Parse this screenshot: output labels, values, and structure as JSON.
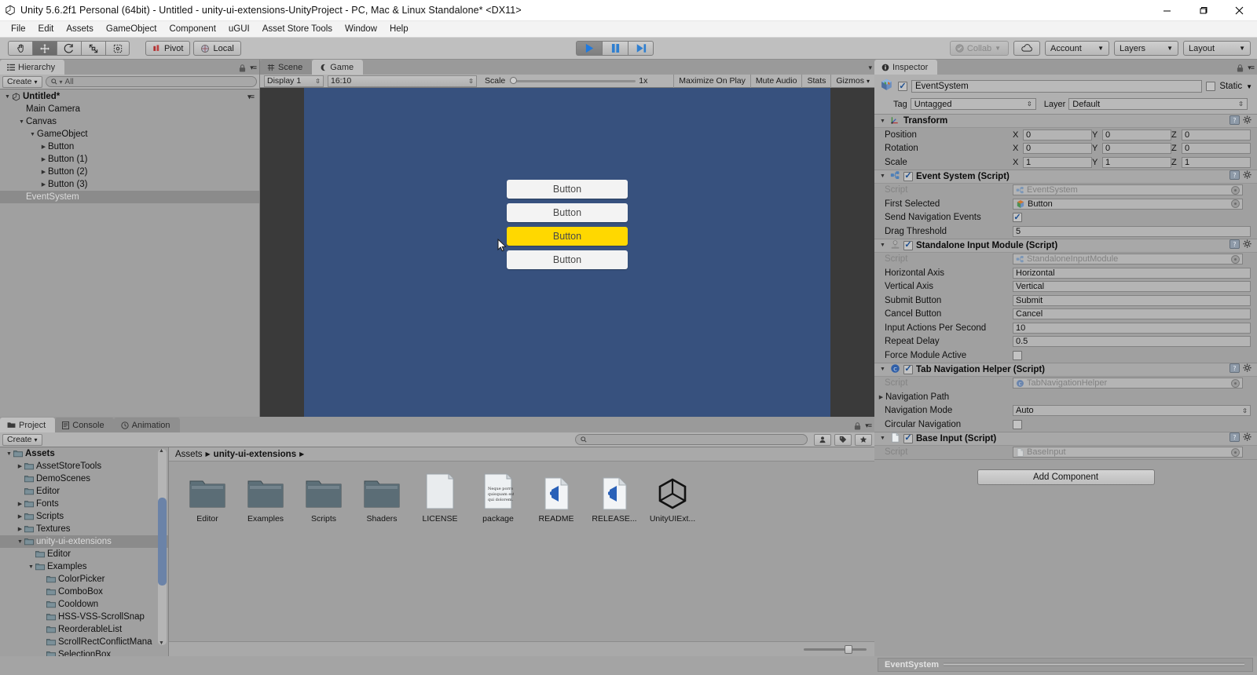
{
  "window": {
    "title": "Unity 5.6.2f1 Personal (64bit) - Untitled - unity-ui-extensions-UnityProject - PC, Mac & Linux Standalone* <DX11>",
    "minimize": "—",
    "maximize": "❐",
    "close": "✕"
  },
  "menubar": {
    "items": [
      "File",
      "Edit",
      "Assets",
      "GameObject",
      "Component",
      "uGUI",
      "Asset Store Tools",
      "Window",
      "Help"
    ]
  },
  "toolbar": {
    "tools": [
      "hand-tool",
      "move-tool",
      "rotate-tool",
      "scale-tool",
      "rect-tool"
    ],
    "active_tool_index": 1,
    "pivot_label": "Pivot",
    "local_label": "Local",
    "play_label": "play-button",
    "pause_label": "pause-button",
    "step_label": "step-button",
    "playing": true,
    "collab_label": "Collab",
    "cloud_label": "cloud-button",
    "account_label": "Account",
    "layers_label": "Layers",
    "layout_label": "Layout"
  },
  "hierarchy": {
    "tab_label": "Hierarchy",
    "create_label": "Create",
    "search_placeholder": "All",
    "scene_name": "Untitled*",
    "items": [
      {
        "label": "Main Camera",
        "depth": 1,
        "arrow": "none",
        "selected": false
      },
      {
        "label": "Canvas",
        "depth": 1,
        "arrow": "open",
        "selected": false
      },
      {
        "label": "GameObject",
        "depth": 2,
        "arrow": "open",
        "selected": false
      },
      {
        "label": "Button",
        "depth": 3,
        "arrow": "closed",
        "selected": false
      },
      {
        "label": "Button (1)",
        "depth": 3,
        "arrow": "closed",
        "selected": false
      },
      {
        "label": "Button (2)",
        "depth": 3,
        "arrow": "closed",
        "selected": false
      },
      {
        "label": "Button (3)",
        "depth": 3,
        "arrow": "closed",
        "selected": false
      },
      {
        "label": "EventSystem",
        "depth": 1,
        "arrow": "none",
        "selected": true
      }
    ]
  },
  "gameview": {
    "tabs": [
      {
        "label": "Scene",
        "active": false,
        "icon": "scene-icon"
      },
      {
        "label": "Game",
        "active": true,
        "icon": "game-icon"
      }
    ],
    "display": "Display 1",
    "aspect": "16:10",
    "scale_label": "Scale",
    "scale_value": "1x",
    "maximize_on_play": "Maximize On Play",
    "mute_audio": "Mute Audio",
    "stats": "Stats",
    "gizmos": "Gizmos",
    "background_color": "#37517e",
    "buttons": [
      {
        "label": "Button",
        "highlighted": false
      },
      {
        "label": "Button",
        "highlighted": false
      },
      {
        "label": "Button",
        "highlighted": true
      },
      {
        "label": "Button",
        "highlighted": false
      }
    ],
    "highlight_color": "#ffd800",
    "button_color": "#f3f3f3"
  },
  "inspector": {
    "tab_label": "Inspector",
    "object_name": "EventSystem",
    "enabled": true,
    "static_label": "Static",
    "tag_label": "Tag",
    "tag_value": "Untagged",
    "layer_label": "Layer",
    "layer_value": "Default",
    "components": [
      {
        "title": "Transform",
        "icon": "transform-icon",
        "has_checkbox": false,
        "rows": [
          {
            "type": "vector3",
            "label": "Position",
            "x": "0",
            "y": "0",
            "z": "0"
          },
          {
            "type": "vector3",
            "label": "Rotation",
            "x": "0",
            "y": "0",
            "z": "0"
          },
          {
            "type": "vector3",
            "label": "Scale",
            "x": "1",
            "y": "1",
            "z": "1"
          }
        ]
      },
      {
        "title": "Event System (Script)",
        "icon": "script-icon",
        "has_checkbox": true,
        "checked": true,
        "rows": [
          {
            "type": "objref",
            "label": "Script",
            "value": "EventSystem",
            "dim": true,
            "icon": "script-icon"
          },
          {
            "type": "objref",
            "label": "First Selected",
            "value": "Button",
            "dim": false,
            "icon": "gameobject-icon"
          },
          {
            "type": "checkbox",
            "label": "Send Navigation Events",
            "checked": true
          },
          {
            "type": "text",
            "label": "Drag Threshold",
            "value": "5"
          }
        ]
      },
      {
        "title": "Standalone Input Module (Script)",
        "icon": "module-icon",
        "has_checkbox": true,
        "checked": true,
        "rows": [
          {
            "type": "objref",
            "label": "Script",
            "value": "StandaloneInputModule",
            "dim": true,
            "icon": "script-icon"
          },
          {
            "type": "text",
            "label": "Horizontal Axis",
            "value": "Horizontal"
          },
          {
            "type": "text",
            "label": "Vertical Axis",
            "value": "Vertical"
          },
          {
            "type": "text",
            "label": "Submit Button",
            "value": "Submit"
          },
          {
            "type": "text",
            "label": "Cancel Button",
            "value": "Cancel"
          },
          {
            "type": "text",
            "label": "Input Actions Per Second",
            "value": "10"
          },
          {
            "type": "text",
            "label": "Repeat Delay",
            "value": "0.5"
          },
          {
            "type": "checkbox",
            "label": "Force Module Active",
            "checked": false
          }
        ]
      },
      {
        "title": "Tab Navigation Helper (Script)",
        "icon": "csharp-icon",
        "has_checkbox": true,
        "checked": true,
        "rows": [
          {
            "type": "objref",
            "label": "Script",
            "value": "TabNavigationHelper",
            "dim": true,
            "icon": "csharp-icon"
          },
          {
            "type": "foldout",
            "label": "Navigation Path"
          },
          {
            "type": "dropdown",
            "label": "Navigation Mode",
            "value": "Auto"
          },
          {
            "type": "checkbox",
            "label": "Circular Navigation",
            "checked": false
          }
        ]
      },
      {
        "title": "Base Input (Script)",
        "icon": "file-icon",
        "has_checkbox": true,
        "checked": true,
        "rows": [
          {
            "type": "objref",
            "label": "Script",
            "value": "BaseInput",
            "dim": true,
            "icon": "file-icon"
          }
        ]
      }
    ],
    "add_component_label": "Add Component"
  },
  "project": {
    "tabs": [
      {
        "label": "Project",
        "active": true,
        "icon": "folder-icon"
      },
      {
        "label": "Console",
        "active": false,
        "icon": "console-icon"
      },
      {
        "label": "Animation",
        "active": false,
        "icon": "clock-icon"
      }
    ],
    "create_label": "Create",
    "search_placeholder": "",
    "tree": [
      {
        "label": "Assets",
        "depth": 0,
        "arrow": "open",
        "bold": true,
        "selected": false
      },
      {
        "label": "AssetStoreTools",
        "depth": 1,
        "arrow": "closed",
        "bold": false,
        "selected": false
      },
      {
        "label": "DemoScenes",
        "depth": 1,
        "arrow": "none",
        "bold": false,
        "selected": false
      },
      {
        "label": "Editor",
        "depth": 1,
        "arrow": "none",
        "bold": false,
        "selected": false
      },
      {
        "label": "Fonts",
        "depth": 1,
        "arrow": "closed",
        "bold": false,
        "selected": false
      },
      {
        "label": "Scripts",
        "depth": 1,
        "arrow": "closed",
        "bold": false,
        "selected": false
      },
      {
        "label": "Textures",
        "depth": 1,
        "arrow": "closed",
        "bold": false,
        "selected": false
      },
      {
        "label": "unity-ui-extensions",
        "depth": 1,
        "arrow": "open",
        "bold": false,
        "selected": true
      },
      {
        "label": "Editor",
        "depth": 2,
        "arrow": "none",
        "bold": false,
        "selected": false
      },
      {
        "label": "Examples",
        "depth": 2,
        "arrow": "open",
        "bold": false,
        "selected": false
      },
      {
        "label": "ColorPicker",
        "depth": 3,
        "arrow": "none",
        "bold": false,
        "selected": false
      },
      {
        "label": "ComboBox",
        "depth": 3,
        "arrow": "none",
        "bold": false,
        "selected": false
      },
      {
        "label": "Cooldown",
        "depth": 3,
        "arrow": "none",
        "bold": false,
        "selected": false
      },
      {
        "label": "HSS-VSS-ScrollSnap",
        "depth": 3,
        "arrow": "none",
        "bold": false,
        "selected": false
      },
      {
        "label": "ReorderableList",
        "depth": 3,
        "arrow": "none",
        "bold": false,
        "selected": false
      },
      {
        "label": "ScrollRectConflictMana",
        "depth": 3,
        "arrow": "none",
        "bold": false,
        "selected": false
      },
      {
        "label": "SelectionBox",
        "depth": 3,
        "arrow": "none",
        "bold": false,
        "selected": false
      }
    ],
    "breadcrumb": [
      "Assets",
      "unity-ui-extensions"
    ],
    "assets": [
      {
        "label": "Editor",
        "kind": "folder"
      },
      {
        "label": "Examples",
        "kind": "folder"
      },
      {
        "label": "Scripts",
        "kind": "folder"
      },
      {
        "label": "Shaders",
        "kind": "folder"
      },
      {
        "label": "LICENSE",
        "kind": "blank-doc"
      },
      {
        "label": "package",
        "kind": "text-doc",
        "preview": "Neque porro quisquam est qui dolorem."
      },
      {
        "label": "README",
        "kind": "vs-doc"
      },
      {
        "label": "RELEASE...",
        "kind": "vs-doc"
      },
      {
        "label": "UnityUIExt...",
        "kind": "unity-doc"
      }
    ]
  },
  "statusbar": {
    "text": "EventSystem"
  }
}
